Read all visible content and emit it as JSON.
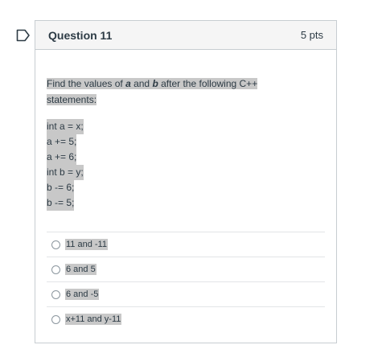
{
  "question": {
    "title": "Question 11",
    "points": "5 pts",
    "prompt_before": "Find the values of ",
    "var_a": "a",
    "prompt_and": " and ",
    "var_b": "b",
    "prompt_after": " after the following C++ statements:",
    "code_lines": [
      "int a = x;",
      "a += 5;",
      "a += 6;",
      "int b = y;",
      "b -= 6;",
      "b -= 5;"
    ],
    "answers": [
      "11 and -11",
      "6 and 5",
      "6 and -5",
      "x+11 and y-11"
    ]
  },
  "colors": {
    "header_bg": "#f5f5f5",
    "highlight": "#c8c8c8",
    "border": "#c7cdd1",
    "bookmark": "#2d3b45"
  },
  "icons": {
    "bookmark": "bookmark-flag-icon",
    "radio": "radio-unchecked-icon"
  }
}
